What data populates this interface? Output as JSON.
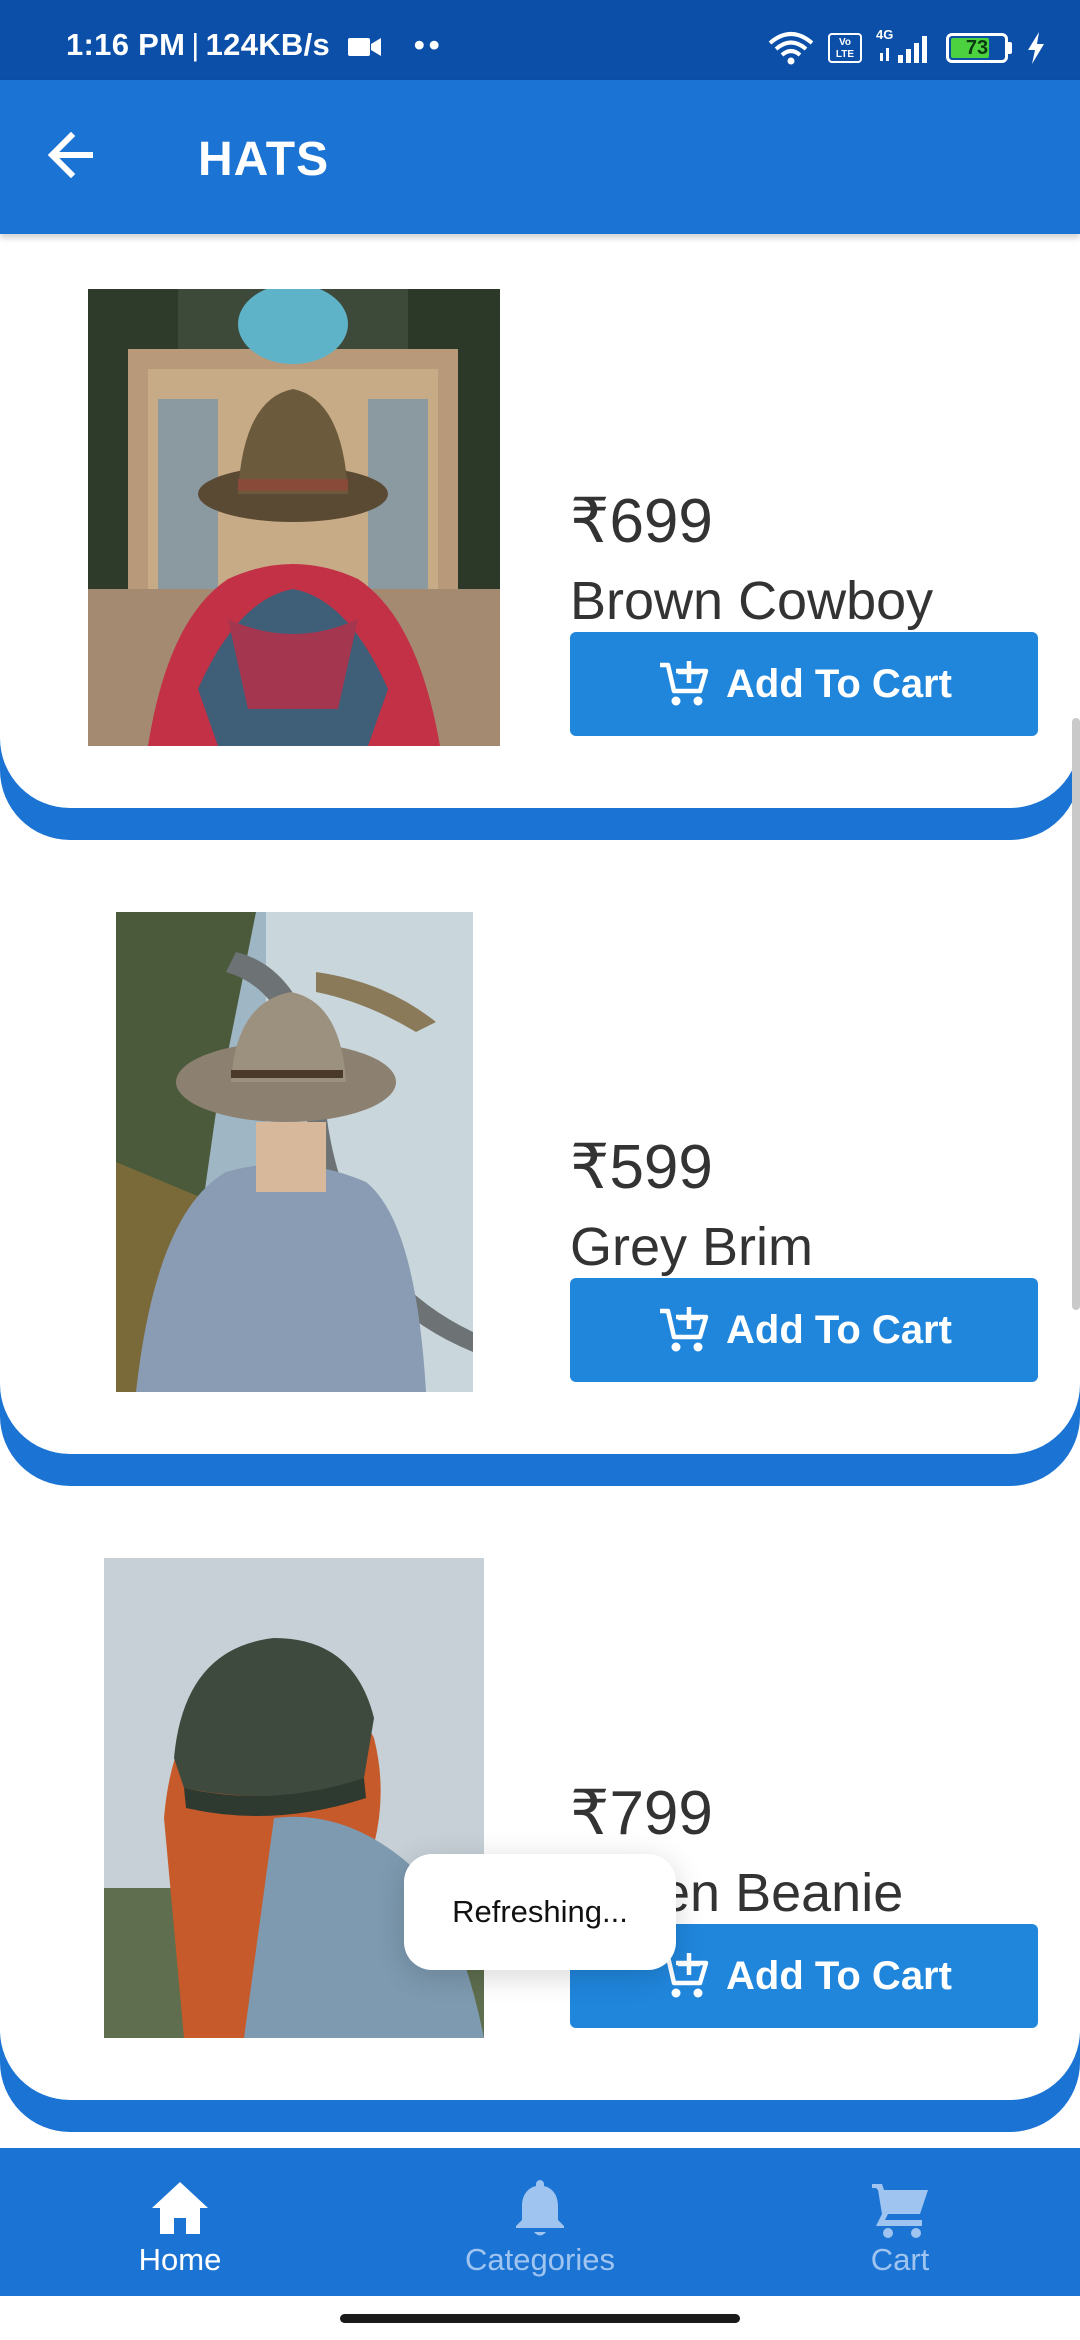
{
  "status_bar": {
    "time": "1:16 PM",
    "net_speed": "124KB/s",
    "separator": "|",
    "dots": "••",
    "volte_label": "Vo LTE",
    "network": "4G",
    "battery": "73"
  },
  "app_bar": {
    "title": "HATS"
  },
  "products": [
    {
      "price": "₹699",
      "name": "Brown Cowboy",
      "button": "Add To Cart"
    },
    {
      "price": "₹599",
      "name": "Grey Brim",
      "button": "Add To Cart"
    },
    {
      "price": "₹799",
      "name": "Green Beanie",
      "button": "Add To Cart"
    }
  ],
  "toast": {
    "message": "Refreshing..."
  },
  "bottom_nav": {
    "items": [
      {
        "label": "Home",
        "icon": "home-icon",
        "active": true
      },
      {
        "label": "Categories",
        "icon": "bell-icon",
        "active": false
      },
      {
        "label": "Cart",
        "icon": "cart-icon",
        "active": false
      }
    ]
  },
  "colors": {
    "status_bar": "#0b4fa8",
    "primary": "#1b74d4",
    "button": "#2086dc",
    "nav_inactive": "#9fc4ef",
    "battery": "#4cd23f"
  }
}
